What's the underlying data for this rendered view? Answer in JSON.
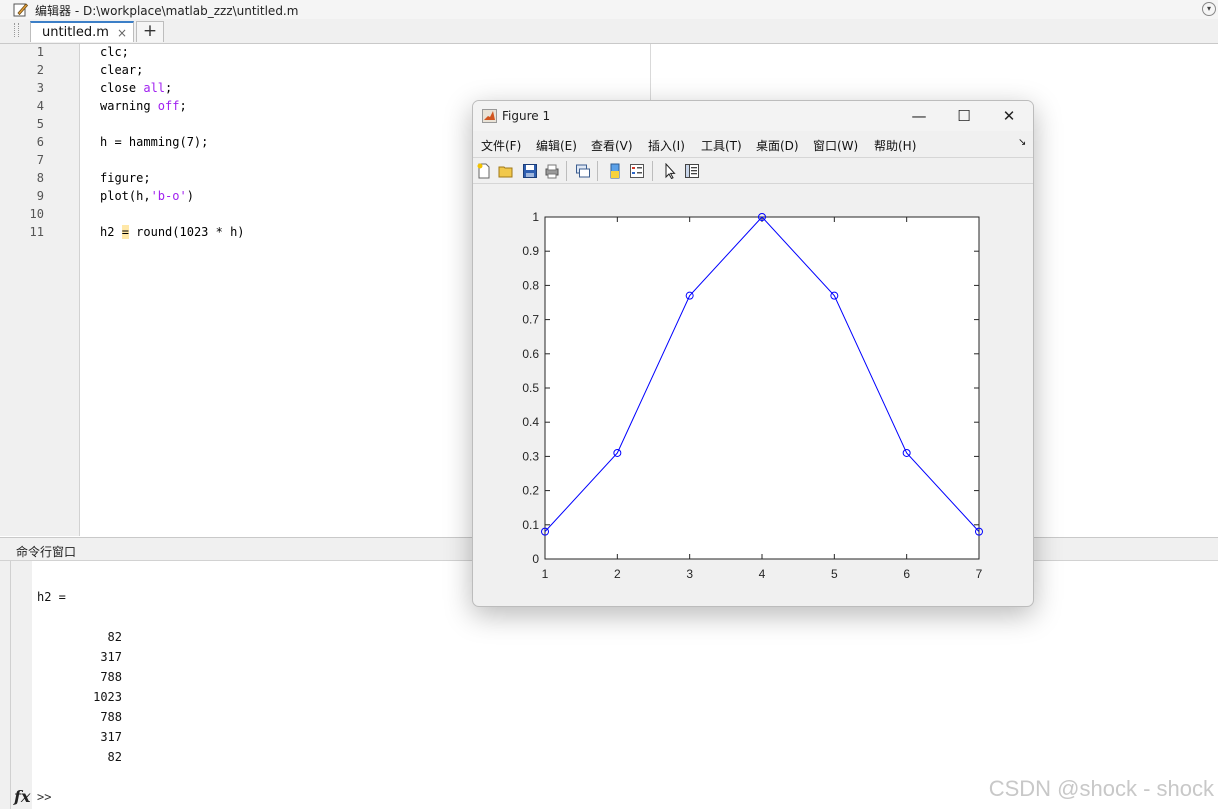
{
  "editor": {
    "title": "编辑器 - D:\\workplace\\matlab_zzz\\untitled.m",
    "tab_label": "untitled.m",
    "tab_close": "×",
    "tab_add": "+",
    "menu_glyph": "▾",
    "lines": [
      {
        "num": "1",
        "pre": "clc;",
        "kw": "",
        "post": ""
      },
      {
        "num": "2",
        "pre": "clear;",
        "kw": "",
        "post": ""
      },
      {
        "num": "3",
        "pre": "close ",
        "kw": "all",
        "post": ";"
      },
      {
        "num": "4",
        "pre": "warning ",
        "kw": "off",
        "post": ";"
      },
      {
        "num": "5",
        "pre": "",
        "kw": "",
        "post": ""
      },
      {
        "num": "6",
        "pre": "h = hamming(7);",
        "kw": "",
        "post": ""
      },
      {
        "num": "7",
        "pre": "",
        "kw": "",
        "post": ""
      },
      {
        "num": "8",
        "pre": "figure;",
        "kw": "",
        "post": ""
      },
      {
        "num": "9",
        "pre": "plot(h,",
        "kw": "'b-o'",
        "post": ")"
      },
      {
        "num": "10",
        "pre": "",
        "kw": "",
        "post": ""
      },
      {
        "num": "11",
        "pre": "h2 ",
        "kw": "",
        "post": "",
        "hl": "=",
        "tail": " round(1023 * h)"
      }
    ]
  },
  "command_window": {
    "title": "命令行窗口",
    "var_line": "h2 =",
    "outputs": [
      "82",
      "317",
      "788",
      "1023",
      "788",
      "317",
      "82"
    ],
    "fx_label": "fx",
    "prompt": ">>"
  },
  "figure": {
    "title": "Figure 1",
    "menus": [
      "文件(F)",
      "编辑(E)",
      "查看(V)",
      "插入(I)",
      "工具(T)",
      "桌面(D)",
      "窗口(W)",
      "帮助(H)"
    ],
    "menu_overflow": "↘",
    "window_buttons": {
      "minimize": "—",
      "maximize": "☐",
      "close": "✕"
    }
  },
  "chart_data": {
    "type": "line",
    "x": [
      1,
      2,
      3,
      4,
      5,
      6,
      7
    ],
    "series": [
      {
        "values": [
          0.08,
          0.31,
          0.77,
          1.0,
          0.77,
          0.31,
          0.08
        ],
        "color": "#0000ff",
        "marker": "circle"
      }
    ],
    "xlim": [
      1,
      7
    ],
    "ylim": [
      0,
      1
    ],
    "xticks": [
      "1",
      "2",
      "3",
      "4",
      "5",
      "6",
      "7"
    ],
    "yticks": [
      "0",
      "0.1",
      "0.2",
      "0.3",
      "0.4",
      "0.5",
      "0.6",
      "0.7",
      "0.8",
      "0.9",
      "1"
    ],
    "grid": false
  },
  "watermark": "CSDN @shock - shock"
}
